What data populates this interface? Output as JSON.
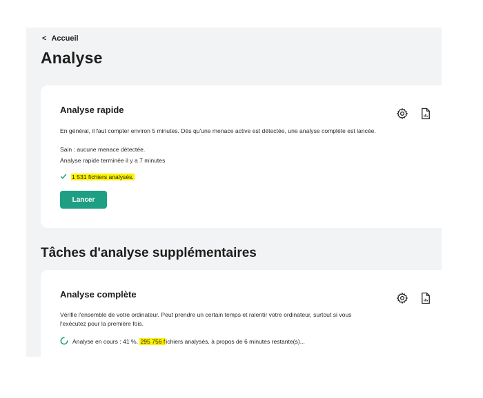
{
  "nav": {
    "back_label": "Accueil"
  },
  "page": {
    "title": "Analyse"
  },
  "quick_scan": {
    "title": "Analyse rapide",
    "description": "En général, il faut compter environ 5 minutes. Dès qu'une menace active est détectée, une analyse complète est lancée.",
    "status": "Sain : aucune menace détectée.",
    "last_run": "Analyse rapide terminée il y a 7 minutes",
    "files_scanned": "1 531 fichiers analysés.",
    "launch_label": "Lancer",
    "settings_icon": "gear-icon",
    "report_icon": "report-icon"
  },
  "additional": {
    "title": "Tâches d'analyse supplémentaires"
  },
  "full_scan": {
    "title": "Analyse complète",
    "description_line1": "Vérifie l'ensemble de votre ordinateur. Peut prendre un certain temps et ralentir votre ordinateur, surtout si vous",
    "description_line2": "l'exécutez pour la première fois.",
    "progress_prefix": "Analyse en cours : 41 %, ",
    "progress_highlight": "295 756 f",
    "progress_suffix": "ichiers analysés, à propos de 6 minutes restante(s)...",
    "progress_value": 41
  },
  "colors": {
    "accent": "#1e9e82",
    "highlight": "#fff200",
    "panel_background": "#f2f3f5",
    "check": "#1e9e82"
  }
}
